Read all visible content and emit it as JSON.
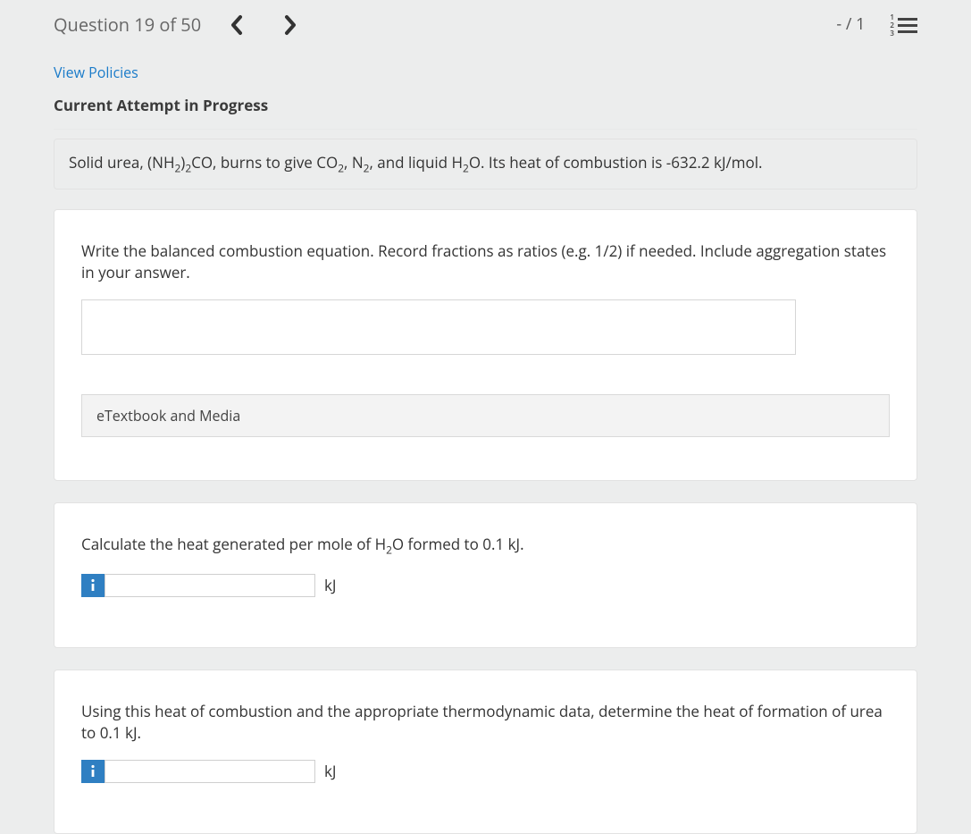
{
  "header": {
    "question_counter": "Question 19 of 50",
    "score": "- / 1"
  },
  "links": {
    "view_policies": "View Policies"
  },
  "attempt_status": "Current Attempt in Progress",
  "statement": {
    "pre": "Solid urea, (NH",
    "s1": "2",
    "mid1": ")",
    "s2": "2",
    "mid2": "CO, burns to give CO",
    "s3": "2",
    "mid3": ", N",
    "s4": "2",
    "mid4": ", and liquid H",
    "s5": "2",
    "tail": "O. Its heat of combustion is -632.2 kJ/mol."
  },
  "part1": {
    "prompt": "Write the balanced combustion equation. Record fractions as ratios (e.g. 1/2) if needed. Include aggregation states in your answer.",
    "value": "",
    "etext_label": "eTextbook and Media"
  },
  "part2": {
    "prompt_pre": "Calculate the heat generated per mole of H",
    "prompt_sub": "2",
    "prompt_post": "O formed to 0.1 kJ.",
    "value": "",
    "unit": "kJ"
  },
  "part3": {
    "prompt": "Using this heat of combustion and the appropriate thermodynamic data, determine the heat of formation of urea to 0.1 kJ.",
    "value": "",
    "unit": "kJ"
  }
}
